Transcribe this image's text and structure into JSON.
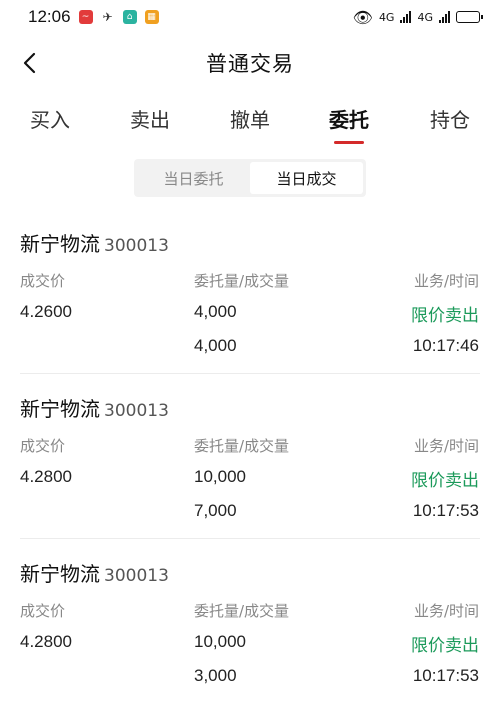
{
  "status_bar": {
    "time": "12:06",
    "network": "4G"
  },
  "header": {
    "title": "普通交易"
  },
  "tabs": [
    {
      "label": "买入"
    },
    {
      "label": "卖出"
    },
    {
      "label": "撤单"
    },
    {
      "label": "委托"
    },
    {
      "label": "持仓"
    }
  ],
  "segment": {
    "left_label": "当日委托",
    "right_label": "当日成交"
  },
  "columns": {
    "price": "成交价",
    "quantity": "委托量/成交量",
    "business_time": "业务/时间"
  },
  "records": [
    {
      "name": "新宁物流",
      "code": "300013",
      "price": "4.2600",
      "order_qty": "4,000",
      "deal_qty": "4,000",
      "business": "限价卖出",
      "time": "10:17:46"
    },
    {
      "name": "新宁物流",
      "code": "300013",
      "price": "4.2800",
      "order_qty": "10,000",
      "deal_qty": "7,000",
      "business": "限价卖出",
      "time": "10:17:53"
    },
    {
      "name": "新宁物流",
      "code": "300013",
      "price": "4.2800",
      "order_qty": "10,000",
      "deal_qty": "3,000",
      "business": "限价卖出",
      "time": "10:17:53"
    }
  ]
}
